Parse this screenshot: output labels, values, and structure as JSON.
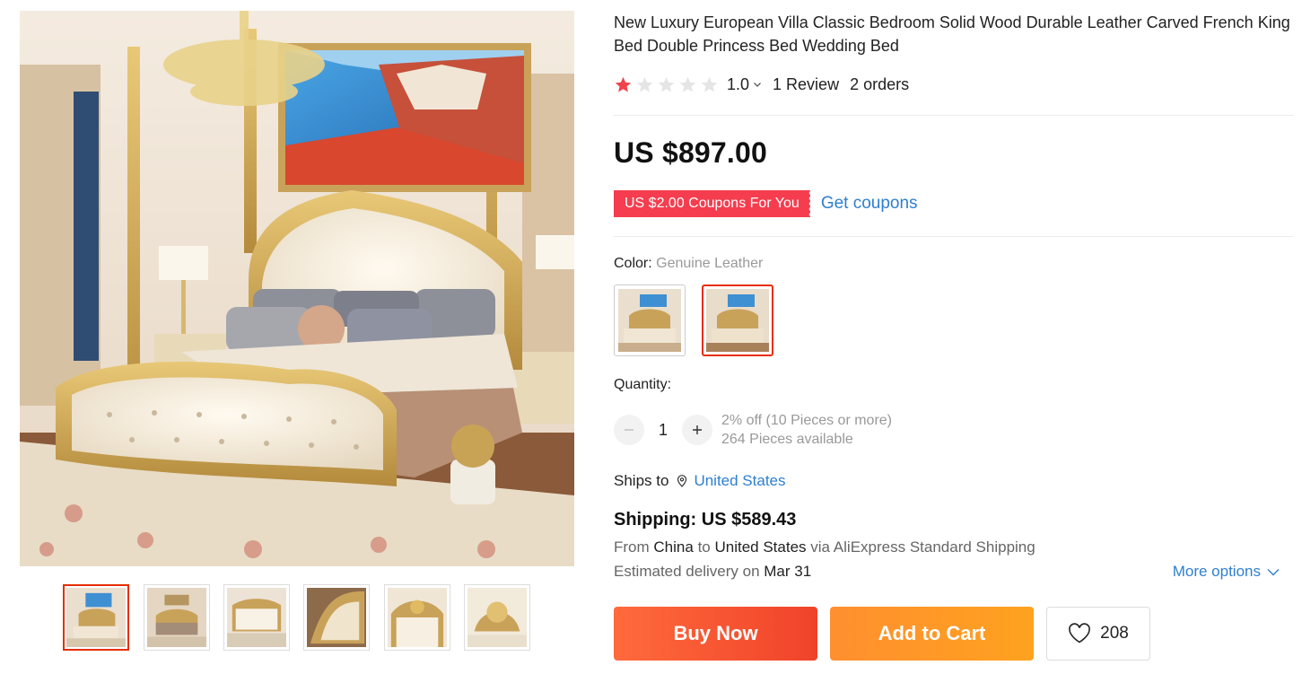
{
  "product": {
    "title": "New Luxury European Villa Classic Bedroom Solid Wood Durable Leather Carved French King Bed Double Princess Bed Wedding Bed",
    "rating_value": "1.0",
    "rating_stars": 1,
    "rating_max": 5,
    "reviews": "1 Review",
    "orders": "2 orders",
    "price": "US $897.00"
  },
  "coupon": {
    "tag": "US $2.00 Coupons For You",
    "link": "Get coupons"
  },
  "color": {
    "label": "Color:",
    "value": "Genuine Leather",
    "options": [
      "Bedroom set view",
      "Genuine Leather"
    ],
    "selected_index": 1
  },
  "quantity": {
    "label": "Quantity:",
    "value": "1",
    "discount": "2% off (10 Pieces or more)",
    "available": "264 Pieces available"
  },
  "shipping": {
    "ships_to_label": "Ships to",
    "ships_to_country": "United States",
    "title": "Shipping: US $589.43",
    "from_prefix": "From",
    "from_country": "China",
    "to_word": "to",
    "to_country": "United States",
    "via": "via AliExpress Standard Shipping",
    "delivery_prefix": "Estimated delivery on",
    "delivery_date": "Mar 31",
    "more_options": "More options"
  },
  "actions": {
    "buy_now": "Buy Now",
    "add_to_cart": "Add to Cart",
    "wishlist_count": "208"
  },
  "gallery": {
    "thumb_count": 6,
    "active_thumb": 0
  },
  "colors": {
    "accent_red": "#e62e04",
    "star_red": "#f0434a",
    "link_blue": "#2e7fcf",
    "coupon_red": "#f53d4f",
    "buy_now_start": "#ff6a3c",
    "add_to_cart_start": "#ff8f2f"
  }
}
